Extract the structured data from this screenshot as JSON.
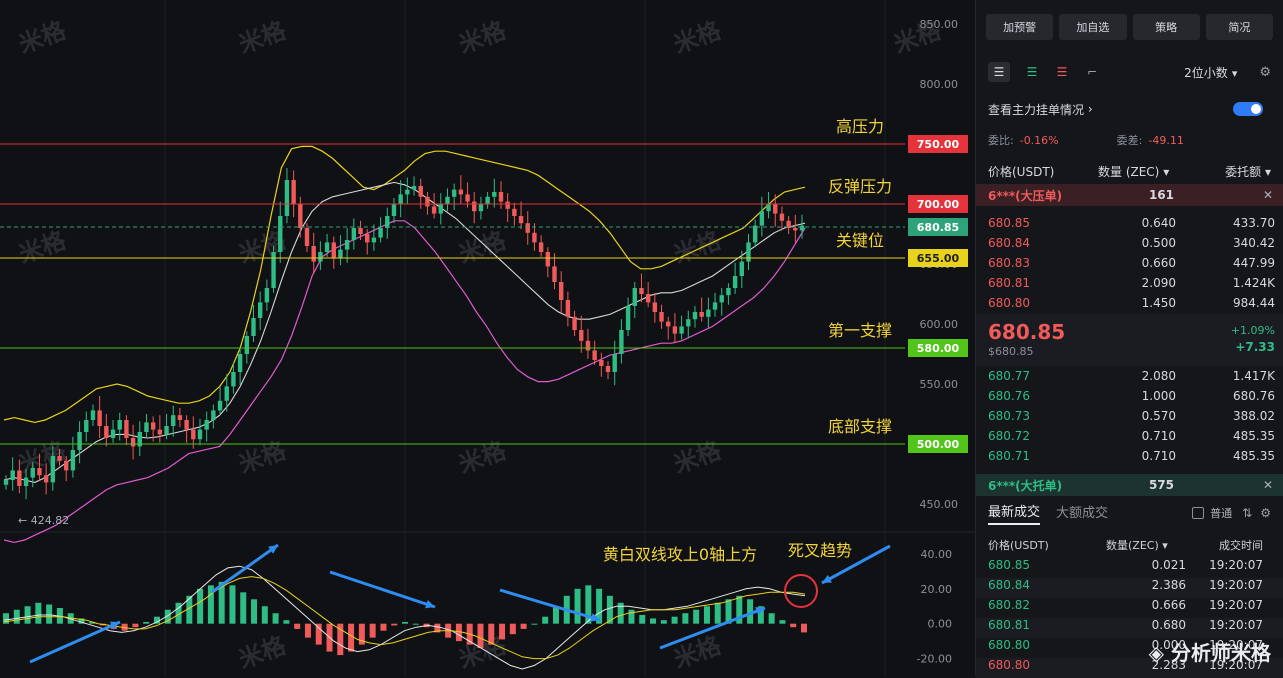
{
  "chart_data": {
    "type": "candlestick",
    "price_axis": {
      "ylim": [
        430,
        870
      ],
      "ticks": [
        850,
        800,
        750,
        700,
        650,
        600,
        550,
        500,
        450
      ],
      "tick_labels": [
        "850.00",
        "800.00",
        "750.00",
        "700.00",
        "650.00",
        "600.00",
        "550.00",
        "500.00",
        "450.00"
      ]
    },
    "macd_axis": {
      "ylim": [
        -30,
        48
      ],
      "ticks": [
        40,
        20,
        0,
        -20
      ],
      "tick_labels": [
        "40.00",
        "20.00",
        "0.00",
        "-20.00"
      ]
    },
    "levels": [
      {
        "value": 750,
        "label": "750.00",
        "annotation": "高压力",
        "color": "#e5333b"
      },
      {
        "value": 700,
        "label": "700.00",
        "annotation": "反弹压力",
        "color": "#e5333b"
      },
      {
        "value": 680.85,
        "label": "680.85",
        "annotation": "",
        "color": "#2ea37a"
      },
      {
        "value": 655,
        "label": "655.00",
        "annotation": "关键位",
        "color": "#e8d21c"
      },
      {
        "value": 580,
        "label": "580.00",
        "annotation": "第一支撑",
        "color": "#52c41a"
      },
      {
        "value": 500,
        "label": "500.00",
        "annotation": "底部支撑",
        "color": "#52c41a"
      }
    ],
    "low_marker": "424.82",
    "macd_annotations": [
      "黄白双线攻上0轴上方",
      "死叉趋势"
    ],
    "watermark": "米格",
    "close_series": [
      470,
      478,
      465,
      472,
      480,
      474,
      468,
      490,
      486,
      478,
      495,
      510,
      520,
      528,
      515,
      505,
      512,
      520,
      505,
      498,
      510,
      518,
      512,
      508,
      515,
      524,
      520,
      512,
      504,
      512,
      520,
      528,
      536,
      548,
      560,
      575,
      590,
      605,
      618,
      630,
      660,
      690,
      720,
      700,
      680,
      665,
      652,
      660,
      668,
      655,
      662,
      670,
      680,
      675,
      668,
      672,
      680,
      690,
      700,
      708,
      712,
      715,
      706,
      698,
      692,
      700,
      706,
      712,
      708,
      702,
      694,
      700,
      706,
      710,
      702,
      696,
      690,
      684,
      676,
      668,
      660,
      648,
      635,
      620,
      606,
      595,
      586,
      578,
      570,
      565,
      560,
      575,
      595,
      615,
      630,
      625,
      618,
      610,
      602,
      598,
      592,
      598,
      604,
      610,
      606,
      612,
      618,
      624,
      630,
      640,
      652,
      668,
      682,
      694,
      700,
      692,
      686,
      680,
      678,
      682
    ],
    "upper_band": [
      520,
      522,
      520,
      518,
      520,
      524,
      528,
      534,
      540,
      546,
      548,
      550,
      548,
      544,
      540,
      538,
      536,
      534,
      534,
      536,
      540,
      548,
      560,
      580,
      610,
      645,
      690,
      730,
      746,
      748,
      748,
      744,
      738,
      730,
      722,
      714,
      712,
      716,
      722,
      728,
      736,
      742,
      744,
      744,
      742,
      740,
      738,
      736,
      734,
      732,
      730,
      728,
      724,
      718,
      712,
      706,
      700,
      694,
      686,
      676,
      664,
      652,
      646,
      646,
      648,
      652,
      656,
      660,
      664,
      668,
      672,
      676,
      680,
      688,
      696,
      704,
      710,
      712,
      714
    ],
    "middle_band": [
      470,
      472,
      470,
      468,
      472,
      478,
      484,
      490,
      496,
      502,
      506,
      508,
      508,
      506,
      505,
      506,
      508,
      510,
      512,
      514,
      518,
      524,
      534,
      548,
      566,
      586,
      610,
      636,
      660,
      680,
      694,
      702,
      706,
      708,
      710,
      712,
      714,
      716,
      718,
      716,
      712,
      706,
      700,
      694,
      688,
      680,
      672,
      664,
      656,
      648,
      640,
      632,
      624,
      616,
      610,
      606,
      604,
      604,
      606,
      608,
      612,
      616,
      620,
      624,
      626,
      626,
      628,
      632,
      636,
      640,
      646,
      652,
      658,
      664,
      670,
      676,
      680,
      682,
      684
    ],
    "lower_band": [
      420,
      418,
      420,
      424,
      428,
      432,
      438,
      444,
      450,
      456,
      462,
      466,
      468,
      470,
      472,
      476,
      480,
      486,
      492,
      494,
      496,
      498,
      508,
      520,
      532,
      544,
      556,
      570,
      590,
      614,
      640,
      656,
      662,
      666,
      670,
      674,
      678,
      682,
      686,
      686,
      680,
      670,
      660,
      648,
      636,
      624,
      610,
      598,
      584,
      572,
      562,
      556,
      552,
      552,
      554,
      558,
      562,
      566,
      570,
      574,
      576,
      578,
      580,
      582,
      584,
      584,
      586,
      590,
      594,
      598,
      604,
      610,
      616,
      622,
      630,
      640,
      652,
      666,
      680
    ],
    "macd_hist": [
      6,
      8,
      10,
      12,
      11,
      9,
      6,
      3,
      1,
      -1,
      -3,
      -4,
      -2,
      1,
      4,
      8,
      12,
      16,
      20,
      22,
      24,
      22,
      18,
      14,
      10,
      6,
      2,
      -3,
      -8,
      -12,
      -16,
      -18,
      -16,
      -12,
      -8,
      -4,
      -1,
      1,
      0,
      -2,
      -5,
      -8,
      -10,
      -12,
      -14,
      -12,
      -9,
      -6,
      -3,
      0,
      4,
      10,
      16,
      20,
      22,
      20,
      16,
      12,
      8,
      5,
      3,
      2,
      4,
      6,
      8,
      10,
      12,
      14,
      16,
      14,
      10,
      6,
      2,
      -2,
      -5
    ],
    "dif_line": [
      2,
      3,
      4,
      5,
      5,
      4,
      2,
      0,
      -2,
      -4,
      -5,
      -4,
      -2,
      1,
      5,
      10,
      16,
      22,
      28,
      32,
      33,
      31,
      26,
      20,
      14,
      8,
      2,
      -4,
      -10,
      -14,
      -16,
      -15,
      -12,
      -8,
      -4,
      -2,
      -1,
      -2,
      -4,
      -8,
      -12,
      -16,
      -20,
      -24,
      -26,
      -24,
      -20,
      -14,
      -8,
      -2,
      4,
      8,
      10,
      10,
      9,
      8,
      8,
      9,
      10,
      12,
      14,
      16,
      18,
      20,
      21,
      20,
      18,
      17,
      16
    ],
    "dea_line": [
      1,
      2,
      3,
      4,
      4,
      4,
      3,
      2,
      0,
      -1,
      -2,
      -3,
      -3,
      -1,
      2,
      6,
      10,
      14,
      19,
      23,
      26,
      27,
      26,
      23,
      19,
      14,
      9,
      4,
      -1,
      -5,
      -9,
      -11,
      -12,
      -11,
      -9,
      -7,
      -5,
      -4,
      -4,
      -5,
      -7,
      -10,
      -13,
      -16,
      -19,
      -20,
      -20,
      -18,
      -14,
      -9,
      -4,
      0,
      4,
      6,
      7,
      8,
      8,
      8,
      9,
      10,
      11,
      12,
      14,
      16,
      17,
      18,
      18,
      18,
      17
    ]
  },
  "panel": {
    "buttons": [
      "加预警",
      "加自选",
      "策略",
      "简况"
    ],
    "digits": "2位小数",
    "main_orders": "查看主力挂单情况",
    "wei_bi_label": "委比:",
    "wei_bi_value": "-0.16%",
    "wei_cha_label": "委差:",
    "wei_cha_value": "-49.11",
    "col_price": "价格(USDT)",
    "col_qty": "数量 (ZEC)",
    "col_total": "委托额",
    "big_ask_label": "6***(大压单)",
    "big_ask_qty": "161",
    "asks": [
      {
        "p": "680.85",
        "q": "0.640",
        "t": "433.70"
      },
      {
        "p": "680.84",
        "q": "0.500",
        "t": "340.42"
      },
      {
        "p": "680.83",
        "q": "0.660",
        "t": "447.99"
      },
      {
        "p": "680.81",
        "q": "2.090",
        "t": "1.424K"
      },
      {
        "p": "680.80",
        "q": "1.450",
        "t": "984.44"
      }
    ],
    "last_price": "680.85",
    "last_price_usd": "$680.85",
    "change_pct": "+1.09%",
    "change_abs": "+7.33",
    "bids": [
      {
        "p": "680.77",
        "q": "2.080",
        "t": "1.417K"
      },
      {
        "p": "680.76",
        "q": "1.000",
        "t": "680.76"
      },
      {
        "p": "680.73",
        "q": "0.570",
        "t": "388.02"
      },
      {
        "p": "680.72",
        "q": "0.710",
        "t": "485.35"
      },
      {
        "p": "680.71",
        "q": "0.710",
        "t": "485.35"
      }
    ],
    "big_bid_label": "6***(大托单)",
    "big_bid_qty": "575",
    "tab_latest": "最新成交",
    "tab_large": "大额成交",
    "normal": "普通",
    "tr_col_price": "价格(USDT)",
    "tr_col_qty": "数量(ZEC)",
    "tr_col_time": "成交时间",
    "trades": [
      {
        "p": "680.85",
        "q": "0.021",
        "t": "19:20:07",
        "c": "green"
      },
      {
        "p": "680.84",
        "q": "2.386",
        "t": "19:20:07",
        "c": "green"
      },
      {
        "p": "680.82",
        "q": "0.666",
        "t": "19:20:07",
        "c": "green"
      },
      {
        "p": "680.81",
        "q": "0.680",
        "t": "19:20:07",
        "c": "green"
      },
      {
        "p": "680.80",
        "q": "0.000",
        "t": "19:20:07",
        "c": "green"
      },
      {
        "p": "680.80",
        "q": "2.283",
        "t": "19:20:07",
        "c": "red"
      }
    ],
    "author": "分析师米格"
  }
}
